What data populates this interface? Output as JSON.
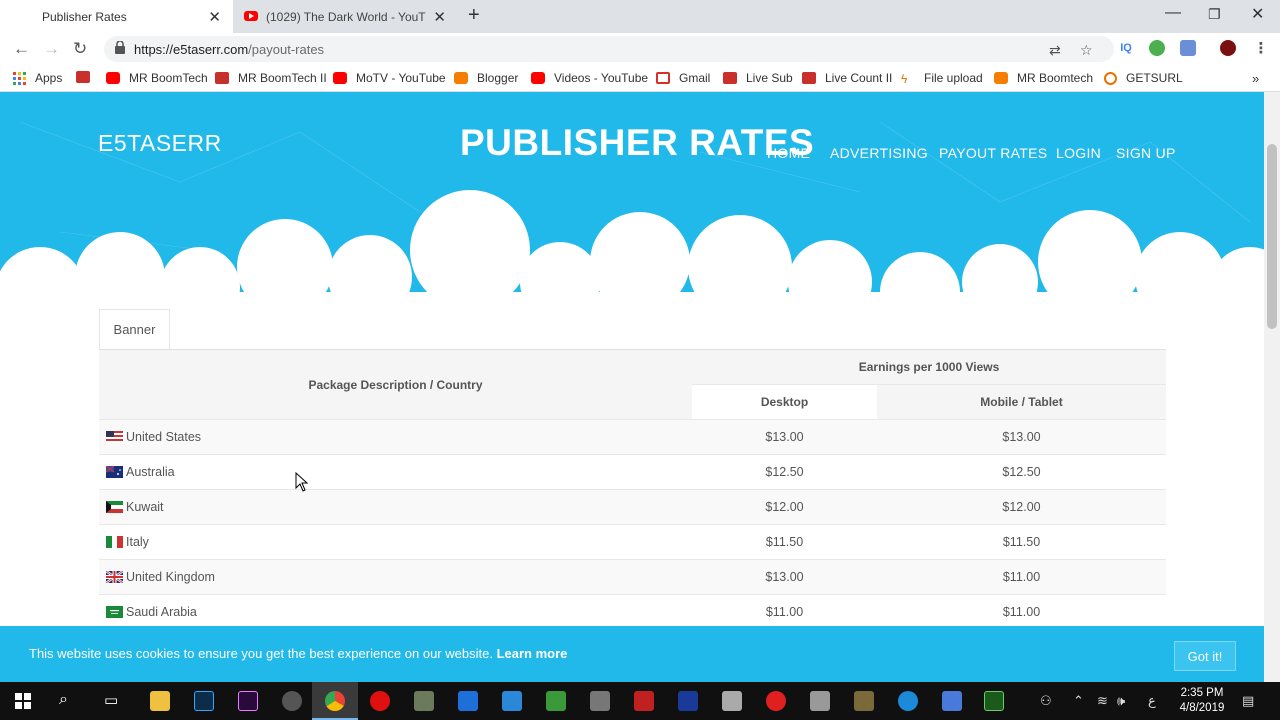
{
  "browser": {
    "tabs": [
      {
        "title": "Publisher Rates",
        "active": true
      },
      {
        "title": "(1029) The Dark World - YouTube",
        "active": false
      }
    ],
    "url_host": "https://e5taserr.com",
    "url_path": "/payout-rates",
    "bookmarks": [
      {
        "label": "Apps",
        "icon": "apps-grid-icon"
      },
      {
        "label": "",
        "icon": "chart-icon"
      },
      {
        "label": "MR BoomTech",
        "icon": "youtube-icon"
      },
      {
        "label": "MR BoomTech II",
        "icon": "chart-icon"
      },
      {
        "label": "MoTV - YouTube",
        "icon": "youtube-icon"
      },
      {
        "label": "Blogger",
        "icon": "blogger-icon"
      },
      {
        "label": "Videos - YouTube",
        "icon": "youtube-icon"
      },
      {
        "label": "Gmail",
        "icon": "gmail-icon"
      },
      {
        "label": "Live Sub",
        "icon": "chart-icon"
      },
      {
        "label": "Live Count II",
        "icon": "chart-icon"
      },
      {
        "label": "File upload",
        "icon": "flash-icon"
      },
      {
        "label": "MR Boomtech",
        "icon": "blogger-icon"
      },
      {
        "label": "GETSURL",
        "icon": "link-icon"
      }
    ]
  },
  "site": {
    "brand": "E5TASERR",
    "title": "PUBLISHER RATES",
    "nav": [
      "HOME",
      "ADVERTISING",
      "PAYOUT RATES",
      "LOGIN",
      "SIGN UP"
    ],
    "colors": {
      "hero": "#21b8ea"
    }
  },
  "rates": {
    "tab_label": "Banner",
    "headers": {
      "package": "Package Description / Country",
      "earnings": "Earnings per 1000 Views",
      "desktop": "Desktop",
      "mobile": "Mobile / Tablet"
    },
    "rows": [
      {
        "country": "United States",
        "flag": "us-flag-icon",
        "desktop": "$13.00",
        "mobile": "$13.00"
      },
      {
        "country": "Australia",
        "flag": "au-flag-icon",
        "desktop": "$12.50",
        "mobile": "$12.50"
      },
      {
        "country": "Kuwait",
        "flag": "kw-flag-icon",
        "desktop": "$12.00",
        "mobile": "$12.00"
      },
      {
        "country": "Italy",
        "flag": "it-flag-icon",
        "desktop": "$11.50",
        "mobile": "$11.50"
      },
      {
        "country": "United Kingdom",
        "flag": "uk-flag-icon",
        "desktop": "$13.00",
        "mobile": "$11.00"
      },
      {
        "country": "Saudi Arabia",
        "flag": "sa-flag-icon",
        "desktop": "$11.00",
        "mobile": "$11.00"
      }
    ]
  },
  "cookie": {
    "text": "This website uses cookies to ensure you get the best experience on our website.",
    "link": "Learn more",
    "button": "Got it!"
  },
  "taskbar": {
    "time": "2:35 PM",
    "date": "4/8/2019",
    "lang": "ع"
  }
}
